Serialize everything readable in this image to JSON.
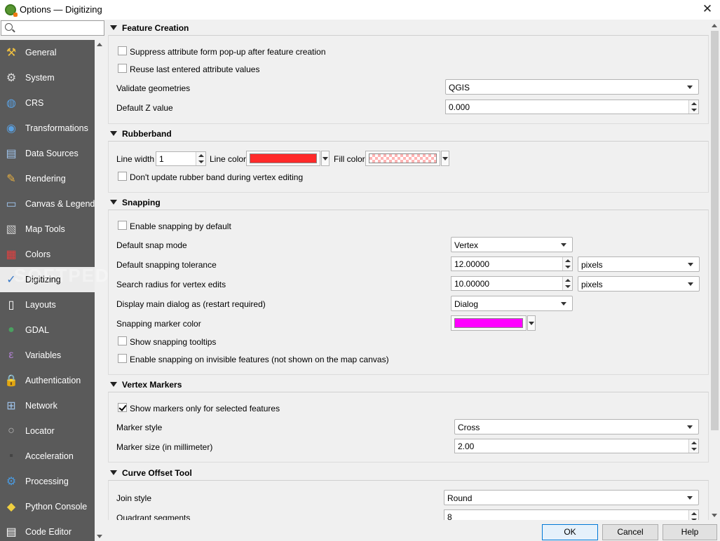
{
  "window": {
    "title": "Options — Digitizing",
    "close": "✕"
  },
  "search": {
    "placeholder": "",
    "value": ""
  },
  "sidebar": {
    "items": [
      {
        "label": "General",
        "icon": "⚒",
        "name": "general",
        "color": "#f0c040"
      },
      {
        "label": "System",
        "icon": "⚙",
        "name": "system",
        "color": "#dddddd"
      },
      {
        "label": "CRS",
        "icon": "◍",
        "name": "crs",
        "color": "#5aa0e0"
      },
      {
        "label": "Transformations",
        "icon": "◉",
        "name": "transformations",
        "color": "#5aa0e0"
      },
      {
        "label": "Data Sources",
        "icon": "▤",
        "name": "data-sources",
        "color": "#9fc4ec"
      },
      {
        "label": "Rendering",
        "icon": "✎",
        "name": "rendering",
        "color": "#e8b040"
      },
      {
        "label": "Canvas & Legend",
        "icon": "▭",
        "name": "canvas-legend",
        "color": "#9fc4ec"
      },
      {
        "label": "Map Tools",
        "icon": "▧",
        "name": "map-tools",
        "color": "#cccccc"
      },
      {
        "label": "Colors",
        "icon": "▦",
        "name": "colors",
        "color": "#e04040"
      },
      {
        "label": "Digitizing",
        "icon": "✓",
        "name": "digitizing",
        "color": "#3a7ac8"
      },
      {
        "label": "Layouts",
        "icon": "▯",
        "name": "layouts",
        "color": "#ffffff"
      },
      {
        "label": "GDAL",
        "icon": "●",
        "name": "gdal",
        "color": "#4aa060"
      },
      {
        "label": "Variables",
        "icon": "ε",
        "name": "variables",
        "color": "#b080d0"
      },
      {
        "label": "Authentication",
        "icon": "🔒",
        "name": "authentication",
        "color": "#f0c040"
      },
      {
        "label": "Network",
        "icon": "⊞",
        "name": "network",
        "color": "#9fc4ec"
      },
      {
        "label": "Locator",
        "icon": "○",
        "name": "locator",
        "color": "#bbbbbb"
      },
      {
        "label": "Acceleration",
        "icon": "▪",
        "name": "acceleration",
        "color": "#444444"
      },
      {
        "label": "Processing",
        "icon": "⚙",
        "name": "processing",
        "color": "#4a9ae0"
      },
      {
        "label": "Python Console",
        "icon": "◆",
        "name": "python-console",
        "color": "#f0d040"
      },
      {
        "label": "Code Editor",
        "icon": "▤",
        "name": "code-editor",
        "color": "#ffffff"
      }
    ],
    "selected_index": 9
  },
  "watermark": "SOFTPEDIA",
  "sections": {
    "feature_creation": {
      "title": "Feature Creation",
      "suppress_popup": {
        "label": "Suppress attribute form pop-up after feature creation",
        "checked": false
      },
      "reuse_values": {
        "label": "Reuse last entered attribute values",
        "checked": false
      },
      "validate_geometries": {
        "label": "Validate geometries",
        "value": "QGIS"
      },
      "default_z": {
        "label": "Default Z value",
        "value": "0.000"
      }
    },
    "rubberband": {
      "title": "Rubberband",
      "line_width": {
        "label": "Line width",
        "value": "1"
      },
      "line_color": {
        "label": "Line color",
        "color": "#ff2a2a"
      },
      "fill_color": {
        "label": "Fill color",
        "color": "#ffb4b4"
      },
      "dont_update": {
        "label": "Don't update rubber band during vertex editing",
        "checked": false
      }
    },
    "snapping": {
      "title": "Snapping",
      "enable_default": {
        "label": "Enable snapping by default",
        "checked": false
      },
      "snap_mode": {
        "label": "Default snap mode",
        "value": "Vertex"
      },
      "tolerance": {
        "label": "Default snapping tolerance",
        "value": "12.00000",
        "unit": "pixels"
      },
      "search_radius": {
        "label": "Search radius for vertex edits",
        "value": "10.00000",
        "unit": "pixels"
      },
      "display_main": {
        "label": "Display main dialog as (restart required)",
        "value": "Dialog"
      },
      "marker_color": {
        "label": "Snapping marker color",
        "color": "#ff00ff"
      },
      "tooltips": {
        "label": "Show snapping tooltips",
        "checked": false
      },
      "invisible": {
        "label": "Enable snapping on invisible features (not shown on the map canvas)",
        "checked": false
      }
    },
    "vertex_markers": {
      "title": "Vertex Markers",
      "only_selected": {
        "label": "Show markers only for selected features",
        "checked": true
      },
      "marker_style": {
        "label": "Marker style",
        "value": "Cross"
      },
      "marker_size": {
        "label": "Marker size (in millimeter)",
        "value": "2.00"
      }
    },
    "curve_offset": {
      "title": "Curve Offset Tool",
      "join_style": {
        "label": "Join style",
        "value": "Round"
      },
      "quadrant_segments": {
        "label": "Quadrant segments",
        "value": "8"
      }
    }
  },
  "buttons": {
    "ok": "OK",
    "cancel": "Cancel",
    "help": "Help"
  }
}
